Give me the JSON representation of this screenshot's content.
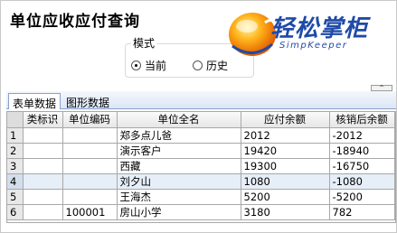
{
  "title": "单位应收应付查询",
  "mode": {
    "legend": "模式",
    "options": [
      {
        "label": "当前",
        "checked": true
      },
      {
        "label": "历史",
        "checked": false
      }
    ]
  },
  "logo": {
    "name": "轻松掌柜",
    "sub": "SimpKeeper"
  },
  "collapse_label": "^",
  "tabs": [
    {
      "label": "表单数据",
      "active": true
    },
    {
      "label": "图形数据",
      "active": false
    }
  ],
  "table": {
    "columns": [
      "类标识",
      "单位编码",
      "单位全名",
      "应付余额",
      "核销后余额"
    ],
    "rows": [
      {
        "num": "1",
        "cells": [
          "",
          "",
          "郑多点儿爸",
          "2012",
          "-2012"
        ]
      },
      {
        "num": "2",
        "cells": [
          "",
          "",
          "演示客户",
          "19420",
          "-18940"
        ]
      },
      {
        "num": "3",
        "cells": [
          "",
          "",
          "西藏",
          "19300",
          "-16750"
        ]
      },
      {
        "num": "4",
        "cells": [
          "",
          "",
          "刘夕山",
          "1080",
          "-1080"
        ]
      },
      {
        "num": "5",
        "cells": [
          "",
          "",
          "王海杰",
          "5200",
          "-5200"
        ]
      },
      {
        "num": "6",
        "cells": [
          "",
          "100001",
          "房山小学",
          "3180",
          "782"
        ]
      }
    ]
  },
  "colors": {
    "accent": "#1f4aa8",
    "selected_row": "#e6eef8"
  }
}
